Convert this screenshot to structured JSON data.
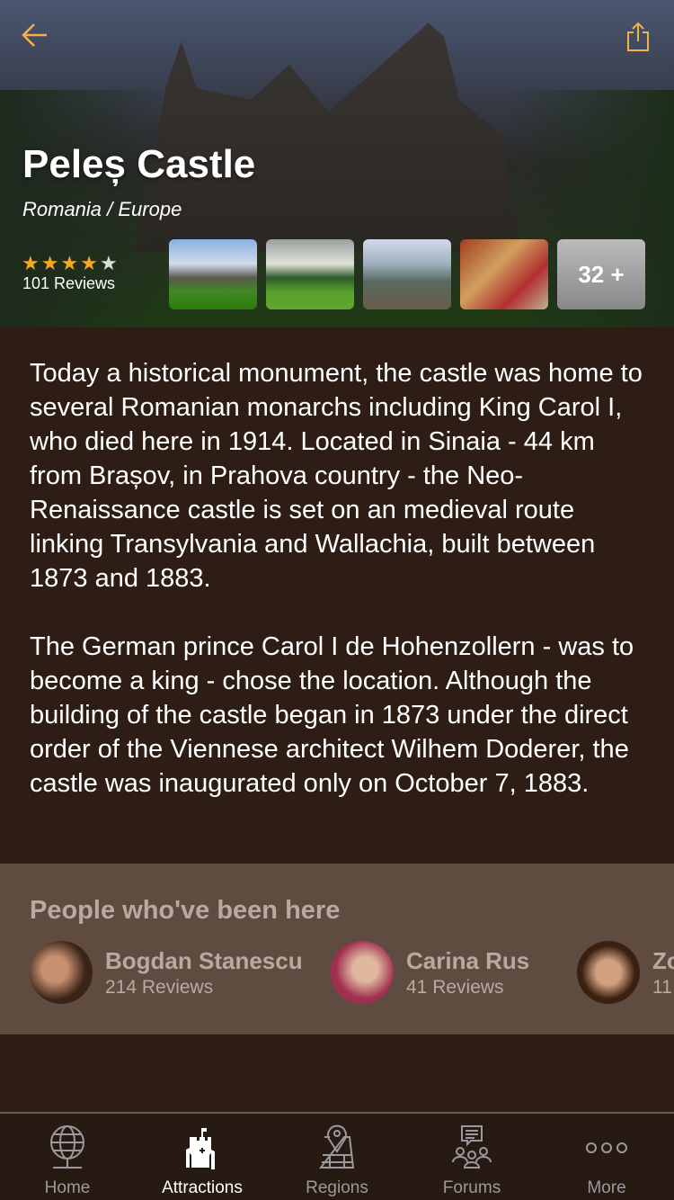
{
  "header": {
    "title": "Peleș Castle",
    "subtitle": "Romania / Europe",
    "rating": 4,
    "rating_max": 5,
    "reviews": "101 Reviews",
    "more_photos": "32 +",
    "accent": "#f5a623"
  },
  "description": [
    "Today a historical monument, the castle was home to several Romanian monarchs including King Carol I, who died here in 1914. Located in Sinaia - 44 km from Brașov, in Prahova country - the Neo-Renaissance castle is set on an medieval route linking Transylvania and Wallachia, built between 1873 and 1883.",
    "The German prince Carol I de Hohenzollern - was to become a king - chose the location. Although the building of the castle began in 1873 under the direct order of the Viennese architect Wilhem Doderer, the castle was inaugurated only on October 7, 1883."
  ],
  "people": {
    "title": "People who've been here",
    "items": [
      {
        "name": "Bogdan Stanescu",
        "reviews": "214 Reviews"
      },
      {
        "name": "Carina Rus",
        "reviews": "41 Reviews"
      },
      {
        "name": "Zo",
        "reviews": "11"
      }
    ]
  },
  "tabs": [
    {
      "label": "Home",
      "icon": "globe-icon"
    },
    {
      "label": "Attractions",
      "icon": "castle-icon",
      "active": true
    },
    {
      "label": "Regions",
      "icon": "map-icon"
    },
    {
      "label": "Forums",
      "icon": "forum-icon"
    },
    {
      "label": "More",
      "icon": "more-icon"
    }
  ]
}
